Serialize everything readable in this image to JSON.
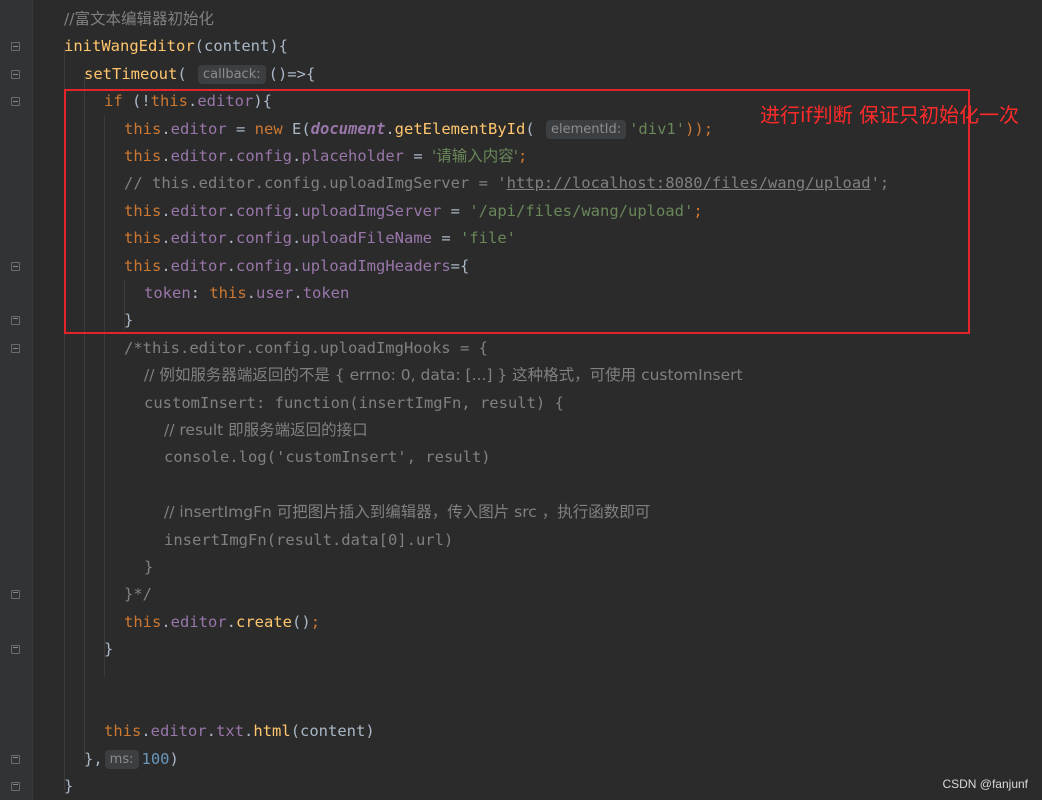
{
  "code_lines": [
    {
      "segs": [
        {
          "t": "//富文本编辑器初始化",
          "c": "cm"
        }
      ]
    },
    {
      "segs": [
        {
          "t": "initWangEditor",
          "c": "fn"
        },
        {
          "t": "(content){",
          "c": ""
        }
      ]
    },
    {
      "segs": [
        {
          "t": "setTimeout",
          "c": "fn"
        },
        {
          "t": "( ",
          "c": ""
        },
        {
          "t": "callback:",
          "c": "hint"
        },
        {
          "t": "()=>{",
          "c": ""
        }
      ]
    },
    {
      "segs": [
        {
          "t": "if",
          "c": "kw"
        },
        {
          "t": " (!",
          "c": ""
        },
        {
          "t": "this",
          "c": "kw"
        },
        {
          "t": ".",
          "c": ""
        },
        {
          "t": "editor",
          "c": "prop"
        },
        {
          "t": "){",
          "c": ""
        }
      ]
    },
    {
      "segs": [
        {
          "t": "this",
          "c": "kw"
        },
        {
          "t": ".",
          "c": ""
        },
        {
          "t": "editor",
          "c": "prop"
        },
        {
          "t": " = ",
          "c": ""
        },
        {
          "t": "new",
          "c": "kw"
        },
        {
          "t": " E(",
          "c": ""
        },
        {
          "t": "document",
          "c": "doc"
        },
        {
          "t": ".",
          "c": ""
        },
        {
          "t": "getElementById",
          "c": "fn"
        },
        {
          "t": "( ",
          "c": ""
        },
        {
          "t": "elementId:",
          "c": "hint"
        },
        {
          "t": "'div1'",
          "c": "str"
        },
        {
          "t": "));",
          "c": "kw"
        }
      ]
    },
    {
      "segs": [
        {
          "t": "this",
          "c": "kw"
        },
        {
          "t": ".",
          "c": ""
        },
        {
          "t": "editor",
          "c": "prop"
        },
        {
          "t": ".",
          "c": ""
        },
        {
          "t": "config",
          "c": "prop"
        },
        {
          "t": ".",
          "c": ""
        },
        {
          "t": "placeholder",
          "c": "prop"
        },
        {
          "t": " = ",
          "c": ""
        },
        {
          "t": "'请输入内容'",
          "c": "str"
        },
        {
          "t": ";",
          "c": "kw"
        }
      ]
    },
    {
      "segs": [
        {
          "t": "// this.editor.config.uploadImgServer = '",
          "c": "cm"
        },
        {
          "t": "http://localhost:8080/files/wang/upload",
          "c": "cm link"
        },
        {
          "t": "';",
          "c": "cm"
        }
      ]
    },
    {
      "segs": [
        {
          "t": "this",
          "c": "kw"
        },
        {
          "t": ".",
          "c": ""
        },
        {
          "t": "editor",
          "c": "prop"
        },
        {
          "t": ".",
          "c": ""
        },
        {
          "t": "config",
          "c": "prop"
        },
        {
          "t": ".",
          "c": ""
        },
        {
          "t": "uploadImgServer",
          "c": "prop"
        },
        {
          "t": " = ",
          "c": ""
        },
        {
          "t": "'/api/files/wang/upload'",
          "c": "str"
        },
        {
          "t": ";",
          "c": "kw"
        }
      ]
    },
    {
      "segs": [
        {
          "t": "this",
          "c": "kw"
        },
        {
          "t": ".",
          "c": ""
        },
        {
          "t": "editor",
          "c": "prop"
        },
        {
          "t": ".",
          "c": ""
        },
        {
          "t": "config",
          "c": "prop"
        },
        {
          "t": ".",
          "c": ""
        },
        {
          "t": "uploadFileName",
          "c": "prop"
        },
        {
          "t": " = ",
          "c": ""
        },
        {
          "t": "'file'",
          "c": "str"
        }
      ]
    },
    {
      "segs": [
        {
          "t": "this",
          "c": "kw"
        },
        {
          "t": ".",
          "c": ""
        },
        {
          "t": "editor",
          "c": "prop"
        },
        {
          "t": ".",
          "c": ""
        },
        {
          "t": "config",
          "c": "prop"
        },
        {
          "t": ".",
          "c": ""
        },
        {
          "t": "uploadImgHeaders",
          "c": "prop"
        },
        {
          "t": "={",
          "c": ""
        }
      ]
    },
    {
      "segs": [
        {
          "t": "token",
          "c": "prop"
        },
        {
          "t": ": ",
          "c": ""
        },
        {
          "t": "this",
          "c": "kw"
        },
        {
          "t": ".",
          "c": ""
        },
        {
          "t": "user",
          "c": "prop"
        },
        {
          "t": ".",
          "c": ""
        },
        {
          "t": "token",
          "c": "prop"
        }
      ]
    },
    {
      "segs": [
        {
          "t": "}",
          "c": ""
        }
      ]
    },
    {
      "segs": [
        {
          "t": "/*this.editor.config.uploadImgHooks = {",
          "c": "cm"
        }
      ]
    },
    {
      "segs": [
        {
          "t": "// 例如服务器端返回的不是 { errno: 0, data: [...] } 这种格式，可使用 customInsert",
          "c": "cm"
        }
      ]
    },
    {
      "segs": [
        {
          "t": "customInsert: function(insertImgFn, result) {",
          "c": "cm"
        }
      ]
    },
    {
      "segs": [
        {
          "t": "// result 即服务端返回的接口",
          "c": "cm"
        }
      ]
    },
    {
      "segs": [
        {
          "t": "console.log('customInsert', result)",
          "c": "cm"
        }
      ]
    },
    {
      "segs": []
    },
    {
      "segs": [
        {
          "t": "// insertImgFn 可把图片插入到编辑器，传入图片 src ，执行函数即可",
          "c": "cm"
        }
      ]
    },
    {
      "segs": [
        {
          "t": "insertImgFn(result.data[0].url)",
          "c": "cm"
        }
      ]
    },
    {
      "segs": [
        {
          "t": "}",
          "c": "cm"
        }
      ]
    },
    {
      "segs": [
        {
          "t": "}*/",
          "c": "cm"
        }
      ]
    },
    {
      "segs": [
        {
          "t": "this",
          "c": "kw"
        },
        {
          "t": ".",
          "c": ""
        },
        {
          "t": "editor",
          "c": "prop"
        },
        {
          "t": ".",
          "c": ""
        },
        {
          "t": "create",
          "c": "fn"
        },
        {
          "t": "()",
          "c": ""
        },
        {
          "t": ";",
          "c": "kw"
        }
      ]
    },
    {
      "segs": [
        {
          "t": "}",
          "c": ""
        }
      ]
    },
    {
      "segs": []
    },
    {
      "segs": []
    },
    {
      "segs": [
        {
          "t": "this",
          "c": "kw"
        },
        {
          "t": ".",
          "c": ""
        },
        {
          "t": "editor",
          "c": "prop"
        },
        {
          "t": ".",
          "c": ""
        },
        {
          "t": "txt",
          "c": "prop"
        },
        {
          "t": ".",
          "c": ""
        },
        {
          "t": "html",
          "c": "fn"
        },
        {
          "t": "(content)",
          "c": ""
        }
      ]
    },
    {
      "segs": [
        {
          "t": "},",
          "c": ""
        },
        {
          "t": "ms:",
          "c": "hint"
        },
        {
          "t": "100",
          "c": "num"
        },
        {
          "t": ")",
          "c": ""
        }
      ]
    },
    {
      "segs": [
        {
          "t": "}",
          "c": ""
        }
      ]
    }
  ],
  "annotation": {
    "text": "进行if判断 保证只初始化一次",
    "color": "#e5232b"
  },
  "watermark": "CSDN @fanjunf",
  "theme": {
    "background": "#2b2b2b",
    "gutter": "#313335",
    "keyword": "#cc7832",
    "function": "#ffc66d",
    "property": "#9876aa",
    "string": "#6a8759",
    "number": "#6897bb",
    "comment": "#808080"
  }
}
